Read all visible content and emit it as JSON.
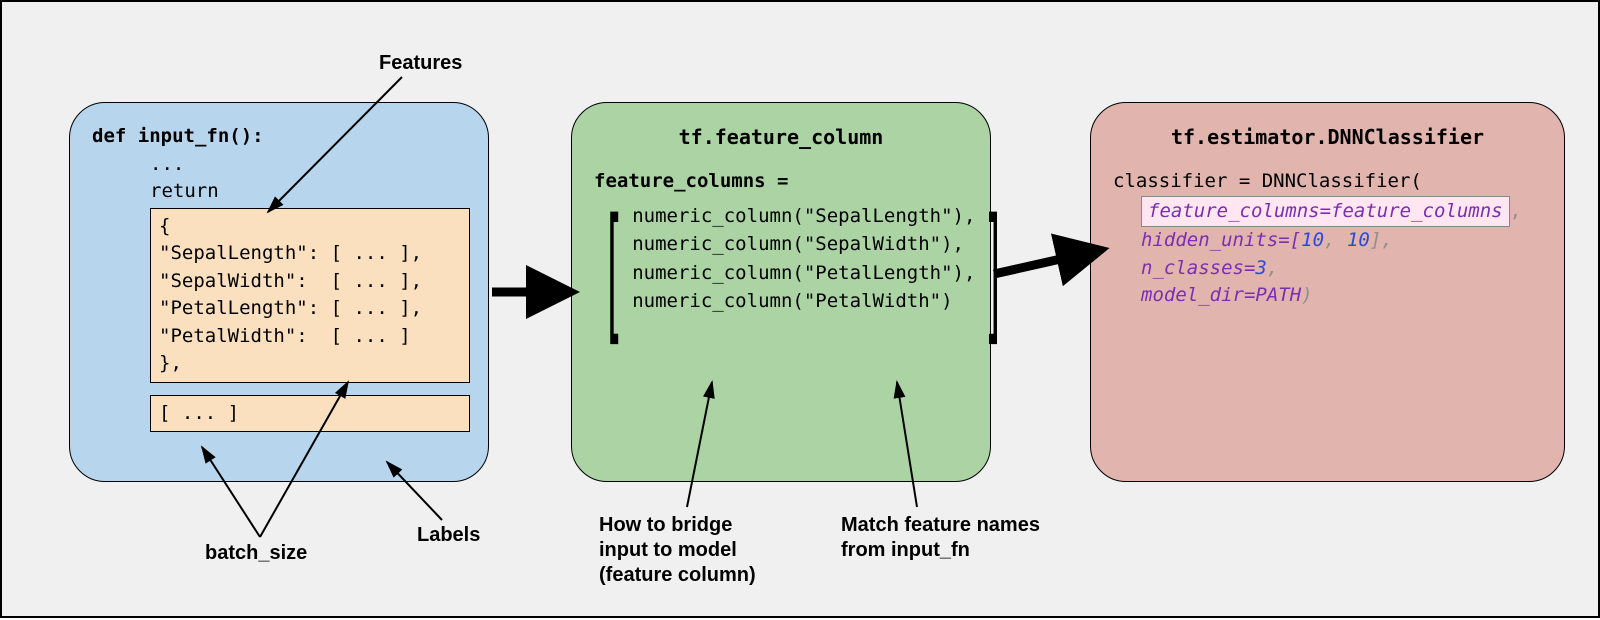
{
  "panel1": {
    "def_line": "def input_fn():",
    "dots": "...",
    "return": "return",
    "dict_open": "{",
    "rows": [
      "\"SepalLength\": [ ... ],",
      "\"SepalWidth\":  [ ... ],",
      "\"PetalLength\": [ ... ],",
      "\"PetalWidth\":  [ ... ]"
    ],
    "dict_close": "},",
    "labels_box": "[ ... ]"
  },
  "panel2": {
    "title": "tf.feature_column",
    "assign": "feature_columns =",
    "cols": [
      "numeric_column(\"SepalLength\"),",
      "numeric_column(\"SepalWidth\"),",
      "numeric_column(\"PetalLength\"),",
      "numeric_column(\"PetalWidth\")"
    ]
  },
  "panel3": {
    "title": "tf.estimator.DNNClassifier",
    "line1": "classifier = DNNClassifier(",
    "fc_line": "feature_columns=feature_columns",
    "hidden_prefix": "hidden_units=[",
    "hidden_a": "10",
    "hidden_sep": ", ",
    "hidden_b": "10",
    "hidden_suffix": "],",
    "nclasses_prefix": "n_classes=",
    "nclasses_val": "3",
    "nclasses_suffix": ",",
    "modeldir_prefix": "model_dir=",
    "modeldir_val": "PATH",
    "close_paren": ")"
  },
  "labels": {
    "features": "Features",
    "batch_size": "batch_size",
    "labels": "Labels",
    "bridge": "How to bridge\ninput to model\n(feature column)",
    "match": "Match feature names\nfrom input_fn"
  }
}
